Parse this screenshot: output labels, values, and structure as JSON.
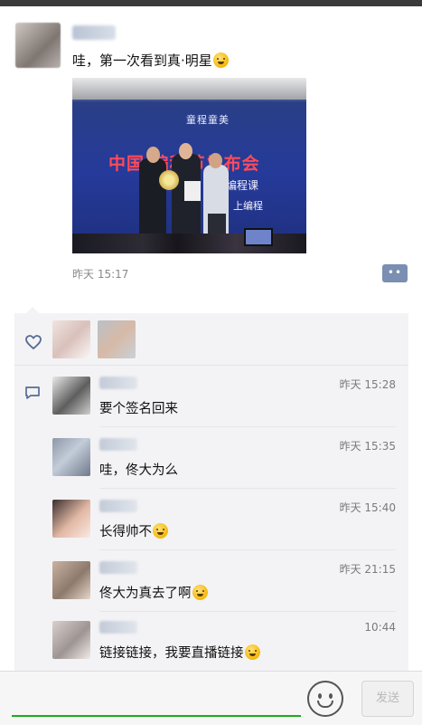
{
  "post": {
    "text": "哇，第一次看到真·明星",
    "emoji": "flushed-face",
    "time": "昨天 15:17",
    "photo": {
      "stage_title": "童程童美",
      "stage_headline": "中国 编程节发布会",
      "stage_sub1": "编程课",
      "stage_sub2": "上编程"
    }
  },
  "comments": [
    {
      "time": "昨天 15:28",
      "text": "要个签名回来",
      "emoji": ""
    },
    {
      "time": "昨天 15:35",
      "text": "哇，佟大为么",
      "emoji": ""
    },
    {
      "time": "昨天 15:40",
      "text": "长得帅不",
      "emoji": "smile-face"
    },
    {
      "time": "昨天 21:15",
      "text": "佟大为真去了啊",
      "emoji": "laughing-tears-face"
    },
    {
      "time": "10:44",
      "text": "链接链接，我要直播链接",
      "emoji": "heart-eyes-face"
    }
  ],
  "input": {
    "send_label": "发送"
  },
  "colors": {
    "link_blue": "#576b95",
    "accent_green": "#1aad19",
    "panel_bg": "#f3f3f5"
  }
}
